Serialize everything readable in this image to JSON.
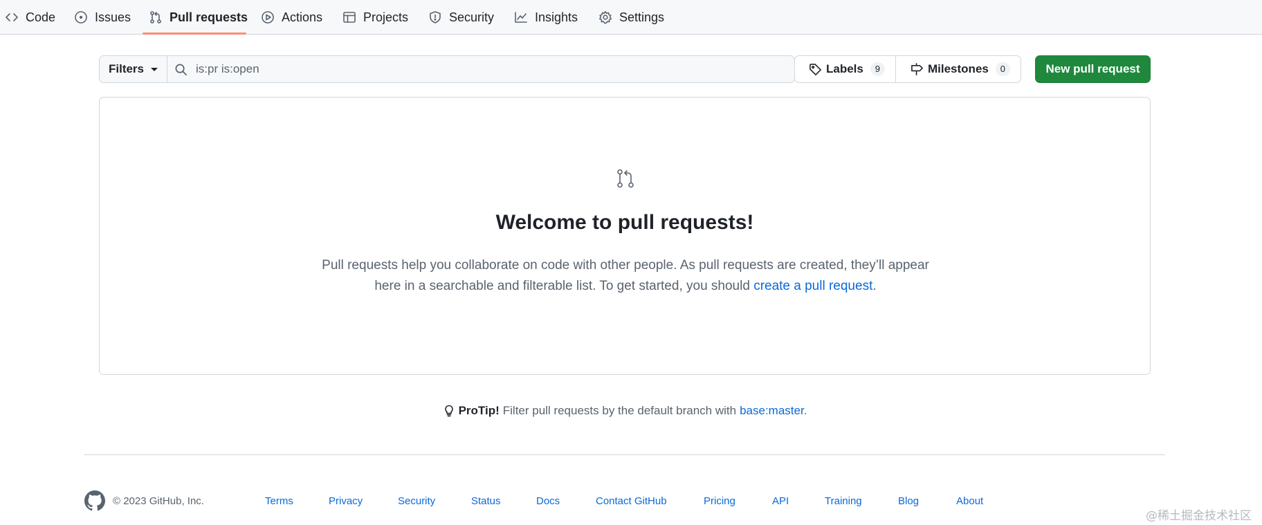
{
  "nav": {
    "tabs": [
      {
        "label": "Code",
        "icon": "code-icon"
      },
      {
        "label": "Issues",
        "icon": "issue-opened-icon"
      },
      {
        "label": "Pull requests",
        "icon": "git-pull-request-icon",
        "active": true
      },
      {
        "label": "Actions",
        "icon": "play-icon"
      },
      {
        "label": "Projects",
        "icon": "table-icon"
      },
      {
        "label": "Security",
        "icon": "shield-icon"
      },
      {
        "label": "Insights",
        "icon": "graph-icon"
      },
      {
        "label": "Settings",
        "icon": "gear-icon"
      }
    ]
  },
  "toolbar": {
    "filters_label": "Filters",
    "search_value": "is:pr is:open",
    "labels_label": "Labels",
    "labels_count": "9",
    "milestones_label": "Milestones",
    "milestones_count": "0",
    "new_pr_label": "New pull request"
  },
  "blankslate": {
    "title": "Welcome to pull requests!",
    "text_before": "Pull requests help you collaborate on code with other people. As pull requests are created, they’ll appear here in a searchable and filterable list. To get started, you should ",
    "link_text": "create a pull request",
    "text_after": "."
  },
  "protip": {
    "label": "ProTip!",
    "text": "Filter pull requests by the default branch with",
    "link": "base:master",
    "end": "."
  },
  "footer": {
    "copyright": "© 2023 GitHub, Inc.",
    "links": [
      "Terms",
      "Privacy",
      "Security",
      "Status",
      "Docs",
      "Contact GitHub",
      "Pricing",
      "API",
      "Training",
      "Blog",
      "About"
    ]
  },
  "watermark": "@稀土掘金技术社区",
  "colors": {
    "accent": "#0969da",
    "primary_button": "#1f883d",
    "tab_underline": "#fd8c73",
    "border": "#d0d7de",
    "muted_text": "#59636e"
  }
}
